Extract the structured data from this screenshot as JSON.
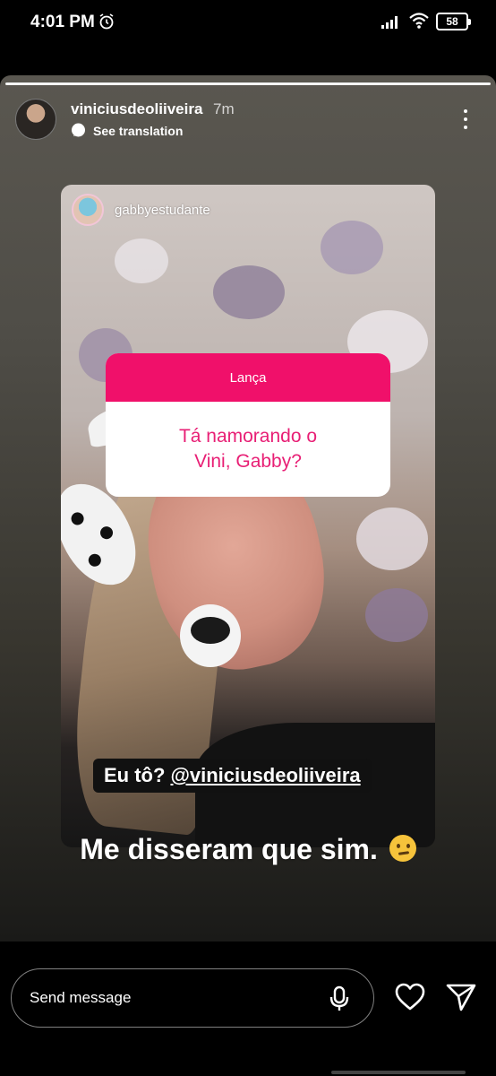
{
  "status_bar": {
    "time": "4:01 PM",
    "battery": "58"
  },
  "story": {
    "username": "viniciusdeoliiveira",
    "time_ago": "7m",
    "see_translation": "See translation",
    "reshared_post": {
      "username": "gabbyestudante",
      "question_header": "Lança",
      "question_text": "Tá namorando o\nVini, Gabby?",
      "reply_text": "Eu tô?",
      "reply_mention": "@viniciusdeoliiveira"
    },
    "caption": "Me disseram que sim."
  },
  "bottom_bar": {
    "message_placeholder": "Send message",
    "icons": [
      "mic-icon",
      "heart-icon",
      "send-icon"
    ]
  },
  "colors": {
    "question_accent": "#f0106a",
    "question_text": "#e81f75"
  }
}
